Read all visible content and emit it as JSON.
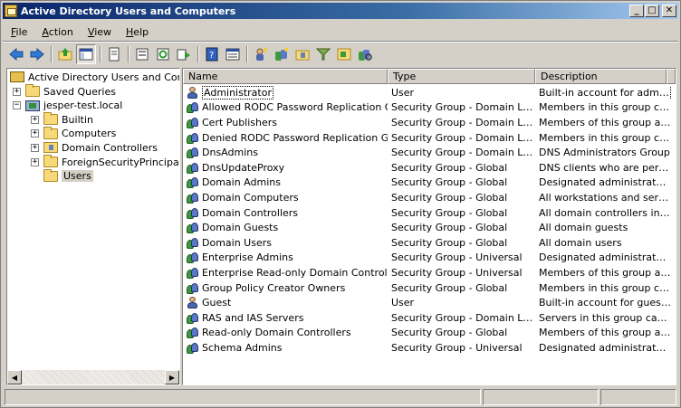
{
  "window": {
    "title": "Active Directory Users and Computers",
    "minimize_label": "_",
    "maximize_label": "□",
    "close_label": "✕"
  },
  "menu": [
    {
      "label": "File",
      "key": "F",
      "rest": "ile"
    },
    {
      "label": "Action",
      "key": "A",
      "rest": "ction"
    },
    {
      "label": "View",
      "key": "V",
      "rest": "iew"
    },
    {
      "label": "Help",
      "key": "H",
      "rest": "elp"
    }
  ],
  "toolbar": [
    {
      "name": "back-icon"
    },
    {
      "name": "forward-icon"
    },
    {
      "sep": true
    },
    {
      "name": "up-folder-icon"
    },
    {
      "name": "show-console-tree-icon",
      "pressed": true
    },
    {
      "sep": true
    },
    {
      "name": "properties-icon"
    },
    {
      "sep": true
    },
    {
      "name": "export-list-icon"
    },
    {
      "name": "refresh-icon"
    },
    {
      "name": "export-icon"
    },
    {
      "sep": true
    },
    {
      "name": "help-icon"
    },
    {
      "name": "details-view-icon"
    },
    {
      "sep": true
    },
    {
      "name": "new-user-icon"
    },
    {
      "name": "new-group-icon"
    },
    {
      "name": "new-ou-icon"
    },
    {
      "name": "filter-icon"
    },
    {
      "name": "add-to-group-icon"
    },
    {
      "name": "find-icon"
    }
  ],
  "tree": {
    "root": "Active Directory Users and Comput",
    "items": [
      {
        "label": "Saved Queries",
        "level": 1,
        "expander": "+",
        "icon": "folder"
      },
      {
        "label": "jesper-test.local",
        "level": 1,
        "expander": "−",
        "icon": "domain"
      },
      {
        "label": "Builtin",
        "level": 2,
        "expander": "+",
        "icon": "folder"
      },
      {
        "label": "Computers",
        "level": 2,
        "expander": "+",
        "icon": "folder"
      },
      {
        "label": "Domain Controllers",
        "level": 2,
        "expander": "+",
        "icon": "ou"
      },
      {
        "label": "ForeignSecurityPrincipals",
        "level": 2,
        "expander": "+",
        "icon": "folder"
      },
      {
        "label": "Users",
        "level": 2,
        "expander": "",
        "icon": "folder",
        "selected": true
      }
    ]
  },
  "list": {
    "columns": {
      "name": "Name",
      "type": "Type",
      "description": "Description"
    },
    "rows": [
      {
        "name": "Administrator",
        "type": "User",
        "description": "Built-in account for admini...",
        "icon": "user"
      },
      {
        "name": "Allowed RODC Password Replication Group",
        "type": "Security Group - Domain Local",
        "description": "Members in this group can...",
        "icon": "group"
      },
      {
        "name": "Cert Publishers",
        "type": "Security Group - Domain Local",
        "description": "Members of this group are...",
        "icon": "group"
      },
      {
        "name": "Denied RODC Password Replication Group",
        "type": "Security Group - Domain Local",
        "description": "Members in this group can...",
        "icon": "group"
      },
      {
        "name": "DnsAdmins",
        "type": "Security Group - Domain Local",
        "description": "DNS Administrators Group",
        "icon": "group"
      },
      {
        "name": "DnsUpdateProxy",
        "type": "Security Group - Global",
        "description": "DNS clients who are permi...",
        "icon": "group"
      },
      {
        "name": "Domain Admins",
        "type": "Security Group - Global",
        "description": "Designated administrators...",
        "icon": "group"
      },
      {
        "name": "Domain Computers",
        "type": "Security Group - Global",
        "description": "All workstations and serve...",
        "icon": "group"
      },
      {
        "name": "Domain Controllers",
        "type": "Security Group - Global",
        "description": "All domain controllers in th...",
        "icon": "group"
      },
      {
        "name": "Domain Guests",
        "type": "Security Group - Global",
        "description": "All domain guests",
        "icon": "group"
      },
      {
        "name": "Domain Users",
        "type": "Security Group - Global",
        "description": "All domain users",
        "icon": "group"
      },
      {
        "name": "Enterprise Admins",
        "type": "Security Group - Universal",
        "description": "Designated administrators...",
        "icon": "group"
      },
      {
        "name": "Enterprise Read-only Domain Controllers",
        "type": "Security Group - Universal",
        "description": "Members of this group are...",
        "icon": "group"
      },
      {
        "name": "Group Policy Creator Owners",
        "type": "Security Group - Global",
        "description": "Members in this group can...",
        "icon": "group"
      },
      {
        "name": "Guest",
        "type": "User",
        "description": "Built-in account for guest ...",
        "icon": "user"
      },
      {
        "name": "RAS and IAS Servers",
        "type": "Security Group - Domain Local",
        "description": "Servers in this group can ...",
        "icon": "group"
      },
      {
        "name": "Read-only Domain Controllers",
        "type": "Security Group - Global",
        "description": "Members of this group are...",
        "icon": "group"
      },
      {
        "name": "Schema Admins",
        "type": "Security Group - Universal",
        "description": "Designated administrators...",
        "icon": "group"
      }
    ]
  }
}
